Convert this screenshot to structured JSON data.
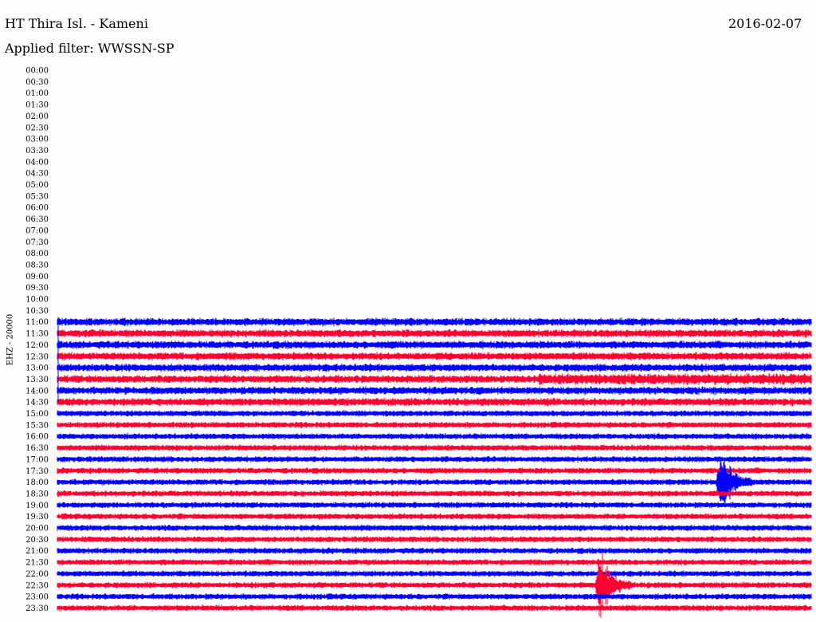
{
  "header": {
    "station": "HT Thira Isl. - Kameni",
    "date": "2016-02-07",
    "filter": "Applied filter: WWSSN-SP"
  },
  "channel_label": "EHZ - 20000",
  "chart_data": {
    "type": "helicorder",
    "title": "HT Thira Isl. - Kameni",
    "date": "2016-02-07",
    "filter": "WWSSN-SP",
    "ylabel": "EHZ - 20000",
    "rows": [
      "00:00",
      "00:30",
      "01:00",
      "01:30",
      "02:00",
      "02:30",
      "03:00",
      "03:30",
      "04:00",
      "04:30",
      "05:00",
      "05:30",
      "06:00",
      "06:30",
      "07:00",
      "07:30",
      "08:00",
      "08:30",
      "09:00",
      "09:30",
      "10:00",
      "10:30",
      "11:00",
      "11:30",
      "12:00",
      "12:30",
      "13:00",
      "13:30",
      "14:00",
      "14:30",
      "15:00",
      "15:30",
      "16:00",
      "16:30",
      "17:00",
      "17:30",
      "18:00",
      "18:30",
      "19:00",
      "19:30",
      "20:00",
      "20:30",
      "21:00",
      "21:30",
      "22:00",
      "22:30",
      "23:00",
      "23:30"
    ],
    "trace_colors": [
      "#0000ff",
      "#ff0033"
    ],
    "data_start_row": "11:00",
    "events": [
      {
        "row": "18:00",
        "x_fraction": 0.88,
        "amplitude_rows": 4
      },
      {
        "row": "22:30",
        "x_fraction": 0.72,
        "amplitude_rows": 4
      }
    ]
  }
}
